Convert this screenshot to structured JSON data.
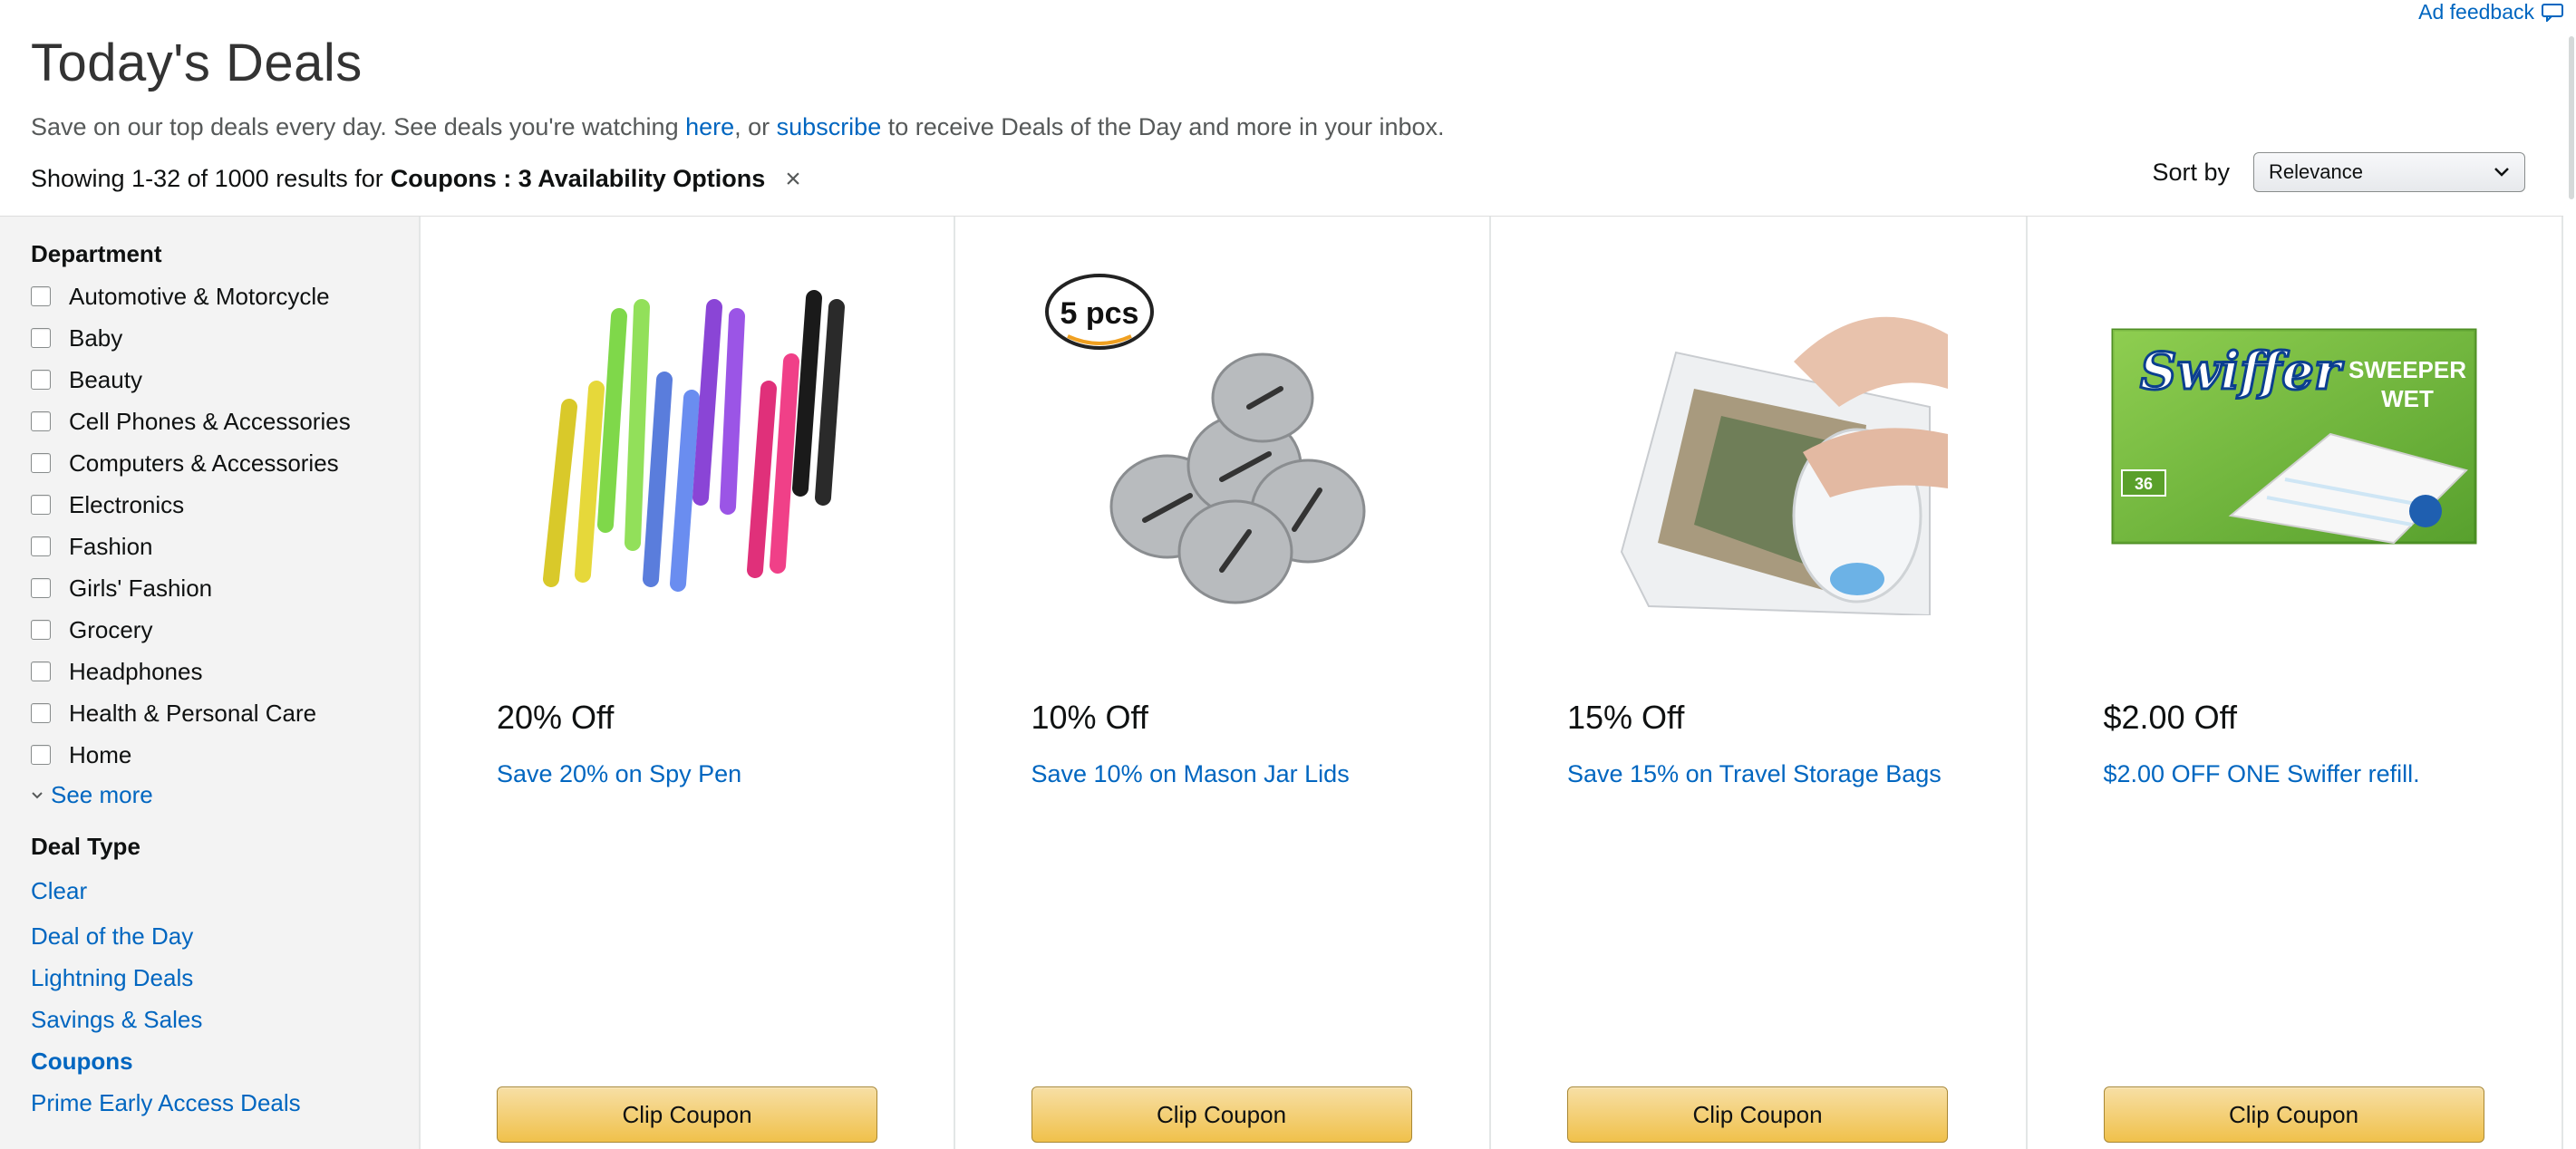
{
  "ad_feedback": {
    "label": "Ad feedback",
    "icon": "speech-bubble-icon"
  },
  "header": {
    "title": "Today's Deals",
    "subtitle_pre": "Save on our top deals every day. See deals you're watching ",
    "subtitle_link1": "here",
    "subtitle_mid": ", or ",
    "subtitle_link2": "subscribe",
    "subtitle_post": " to receive Deals of the Day and more in your inbox."
  },
  "results": {
    "prefix": "Showing 1-32 of 1000 results for",
    "filter": "Coupons : 3 Availability Options",
    "clear_icon": "×"
  },
  "sort": {
    "label": "Sort by",
    "selected": "Relevance"
  },
  "sidebar": {
    "department_title": "Department",
    "departments": [
      "Automotive & Motorcycle",
      "Baby",
      "Beauty",
      "Cell Phones & Accessories",
      "Computers & Accessories",
      "Electronics",
      "Fashion",
      "Girls' Fashion",
      "Grocery",
      "Headphones",
      "Health & Personal Care",
      "Home"
    ],
    "see_more": "See more",
    "deal_type_title": "Deal Type",
    "deal_types": [
      "Clear",
      "Deal of the Day",
      "Lightning Deals",
      "Savings & Sales",
      "Coupons",
      "Prime Early Access Deals"
    ],
    "active_deal_type": "Coupons"
  },
  "deals": [
    {
      "discount": "20% Off",
      "title": "Save 20% on Spy Pen",
      "button": "Clip Coupon",
      "image": "spy-pens-image"
    },
    {
      "discount": "10% Off",
      "title": "Save 10% on Mason Jar Lids",
      "button": "Clip Coupon",
      "image": "mason-jar-lids-image",
      "badge": "5 pcs"
    },
    {
      "discount": "15% Off",
      "title": "Save 15% on Travel Storage Bags",
      "button": "Clip Coupon",
      "image": "storage-bag-image"
    },
    {
      "discount": "$2.00 Off",
      "title": "$2.00 OFF ONE Swiffer refill.",
      "button": "Clip Coupon",
      "image": "swiffer-box-image",
      "box_brand": "Swiffer",
      "box_line1": "SWEEPER",
      "box_line2": "WET",
      "box_count": "36"
    }
  ],
  "colors": {
    "link": "#0066c0",
    "button_top": "#f7dfa5",
    "button_bottom": "#f0c14b",
    "sidebar_bg": "#f3f3f3"
  }
}
